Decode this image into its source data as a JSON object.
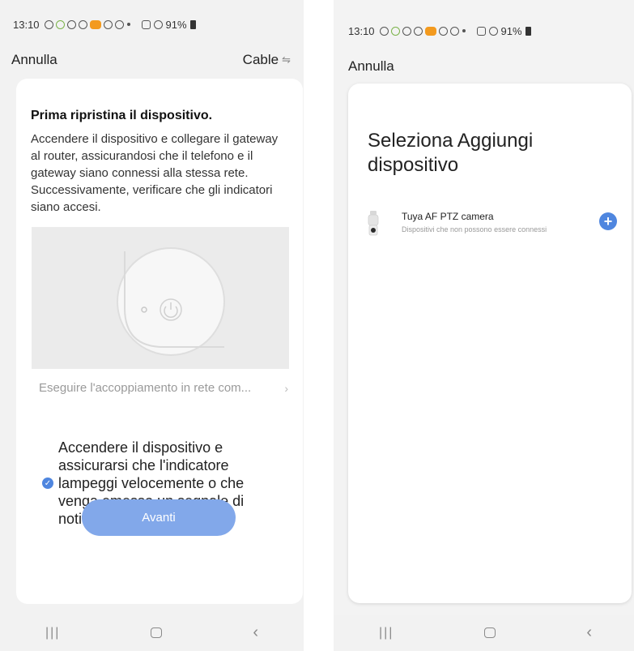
{
  "left_screen": {
    "status": {
      "time": "13:10",
      "battery": "91%"
    },
    "topbar": {
      "cancel_label": "Annulla",
      "network_label": "Cable"
    },
    "card": {
      "title": "Prima ripristina il dispositivo.",
      "description": "Accendere il dispositivo e collegare il gateway al router, assicurandosi che il telefono e il gateway siano connessi alla stessa rete. Successivamente, verificare che gli indicatori siano accesi.",
      "pairing_link": "Eseguire l'accoppiamento in rete com...",
      "confirm_text": "Accendere il dispositivo e assicurarsi che l'indicatore lampeggi velocemente o che venga emesso un segnale di notifica.",
      "confirm_checked": true,
      "next_button": "Avanti"
    }
  },
  "right_screen": {
    "status": {
      "time": "13:10",
      "battery": "91%"
    },
    "topbar": {
      "cancel_label": "Annulla"
    },
    "card": {
      "title": "Seleziona Aggiungi dispositivo",
      "devices": [
        {
          "name": "Tuya AF PTZ camera",
          "subtitle": "Dispositivi che non possono essere connessi"
        }
      ]
    }
  },
  "colors": {
    "accent": "#4f86df",
    "button": "#82a8ea",
    "background": "#f2f2f2"
  },
  "icons": [
    "cable-icon",
    "power-icon",
    "chevron-right-icon",
    "check-circle-icon",
    "camera-icon",
    "add-icon",
    "recent-apps-icon",
    "home-icon",
    "back-icon"
  ]
}
